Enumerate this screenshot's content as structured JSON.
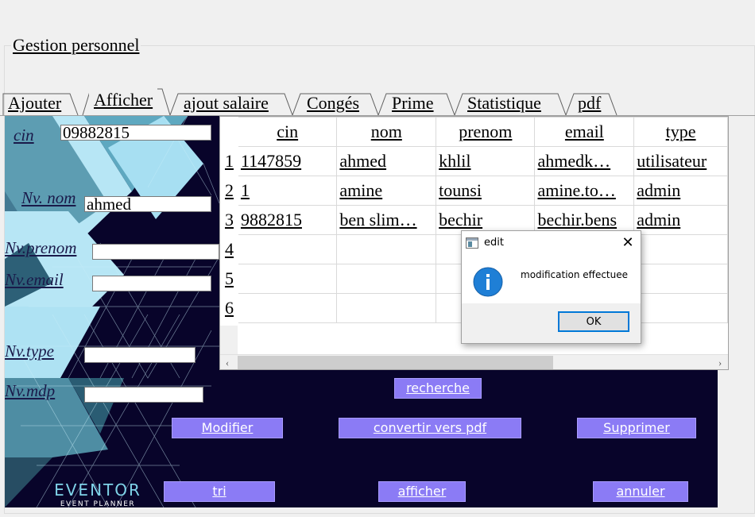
{
  "group": {
    "title": "Gestion personnel"
  },
  "tabs": [
    {
      "label": "Ajouter"
    },
    {
      "label": "Afficher"
    },
    {
      "label": "ajout salaire"
    },
    {
      "label": "Congés"
    },
    {
      "label": " Prime"
    },
    {
      "label": "Statistique"
    },
    {
      "label": "pdf"
    }
  ],
  "active_tab": "Afficher",
  "form": {
    "cin_label": "cin",
    "cin_value": "09882815",
    "nom_label": "Nv. nom",
    "nom_value": "ahmed",
    "prenom_label": "Nv.prenom",
    "prenom_value": "",
    "email_label": "Nv.email",
    "email_value": "",
    "type_label": "Nv.type",
    "type_value": "",
    "mdp_label": "Nv.mdp",
    "mdp_value": ""
  },
  "table": {
    "columns": [
      "cin",
      "nom",
      "prenom",
      "email",
      "type"
    ],
    "row_numbers": [
      "1",
      "2",
      "3",
      "4",
      "5",
      "6"
    ],
    "rows": [
      [
        "1147859",
        "ahmed",
        "khlil",
        "ahmedk…",
        "utilisateur"
      ],
      [
        "1",
        "amine",
        "tounsi",
        "amine.to…",
        "admin"
      ],
      [
        "9882815",
        "ben slim…",
        "bechir",
        "bechir.bens",
        "admin"
      ],
      [
        "",
        "",
        "",
        "",
        ""
      ],
      [
        "",
        "",
        "",
        "",
        ""
      ],
      [
        "",
        "",
        "",
        "",
        ""
      ]
    ]
  },
  "buttons": {
    "recherche": "recherche",
    "modifier": "Modifier",
    "convertir": "convertir vers pdf",
    "supprimer": "Supprimer",
    "tri": "tri",
    "afficher": "afficher",
    "annuler": "annuler"
  },
  "logo": {
    "title": "EVENTOR",
    "subtitle": "EVENT PLANNER"
  },
  "dialog": {
    "title": "edit",
    "message": "modification effectuee",
    "ok_label": "OK",
    "close_glyph": "✕"
  },
  "colors": {
    "panel_bg": "#08042a",
    "button_bg": "#8b7bf5",
    "accent_cyan": "#7fd3e8",
    "dialog_focus": "#0078d7",
    "info_icon": "#1f7fd6"
  },
  "icons": {
    "app": "window-app-icon",
    "info": "info-icon",
    "close": "close-icon",
    "scroll_left": "chevron-left-icon",
    "scroll_right": "chevron-right-icon"
  }
}
